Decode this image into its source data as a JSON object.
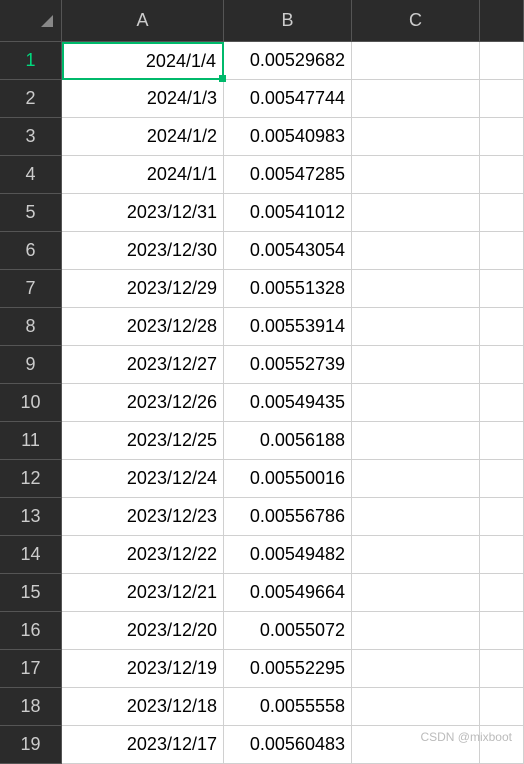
{
  "columns": [
    "A",
    "B",
    "C",
    ""
  ],
  "selected_cell": {
    "row": 1,
    "col": "A"
  },
  "rows": [
    {
      "num": "1",
      "A": "2024/1/4",
      "B": "0.00529682",
      "C": "",
      "D": ""
    },
    {
      "num": "2",
      "A": "2024/1/3",
      "B": "0.00547744",
      "C": "",
      "D": ""
    },
    {
      "num": "3",
      "A": "2024/1/2",
      "B": "0.00540983",
      "C": "",
      "D": ""
    },
    {
      "num": "4",
      "A": "2024/1/1",
      "B": "0.00547285",
      "C": "",
      "D": ""
    },
    {
      "num": "5",
      "A": "2023/12/31",
      "B": "0.00541012",
      "C": "",
      "D": ""
    },
    {
      "num": "6",
      "A": "2023/12/30",
      "B": "0.00543054",
      "C": "",
      "D": ""
    },
    {
      "num": "7",
      "A": "2023/12/29",
      "B": "0.00551328",
      "C": "",
      "D": ""
    },
    {
      "num": "8",
      "A": "2023/12/28",
      "B": "0.00553914",
      "C": "",
      "D": ""
    },
    {
      "num": "9",
      "A": "2023/12/27",
      "B": "0.00552739",
      "C": "",
      "D": ""
    },
    {
      "num": "10",
      "A": "2023/12/26",
      "B": "0.00549435",
      "C": "",
      "D": ""
    },
    {
      "num": "11",
      "A": "2023/12/25",
      "B": "0.0056188",
      "C": "",
      "D": ""
    },
    {
      "num": "12",
      "A": "2023/12/24",
      "B": "0.00550016",
      "C": "",
      "D": ""
    },
    {
      "num": "13",
      "A": "2023/12/23",
      "B": "0.00556786",
      "C": "",
      "D": ""
    },
    {
      "num": "14",
      "A": "2023/12/22",
      "B": "0.00549482",
      "C": "",
      "D": ""
    },
    {
      "num": "15",
      "A": "2023/12/21",
      "B": "0.00549664",
      "C": "",
      "D": ""
    },
    {
      "num": "16",
      "A": "2023/12/20",
      "B": "0.0055072",
      "C": "",
      "D": ""
    },
    {
      "num": "17",
      "A": "2023/12/19",
      "B": "0.00552295",
      "C": "",
      "D": ""
    },
    {
      "num": "18",
      "A": "2023/12/18",
      "B": "0.0055558",
      "C": "",
      "D": ""
    },
    {
      "num": "19",
      "A": "2023/12/17",
      "B": "0.00560483",
      "C": "",
      "D": ""
    }
  ],
  "watermark": "CSDN @mixboot"
}
